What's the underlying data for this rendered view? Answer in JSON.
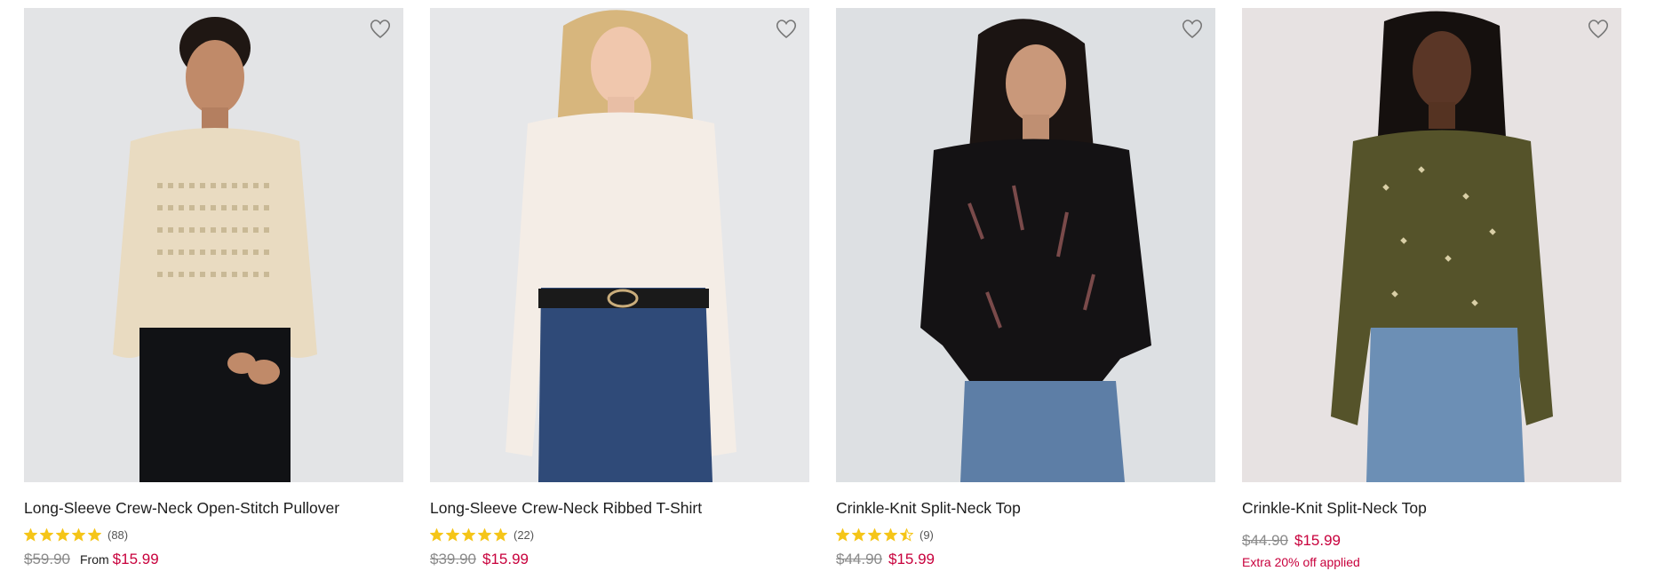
{
  "colors": {
    "sale": "#c8003c",
    "star": "#f5c518",
    "strike": "#8a8a8a"
  },
  "products": [
    {
      "title": "Long-Sleeve Crew-Neck Open-Stitch Pullover",
      "rating": 5,
      "rating_count": "(88)",
      "original_price": "$59.90",
      "price_prefix": "From",
      "sale_price": "$15.99",
      "image_icon": "model-photo",
      "wishlist_icon": "heart-outline-icon"
    },
    {
      "title": "Long-Sleeve Crew-Neck Ribbed T-Shirt",
      "rating": 5,
      "rating_count": "(22)",
      "original_price": "$39.90",
      "sale_price": "$15.99",
      "image_icon": "model-photo",
      "wishlist_icon": "heart-outline-icon"
    },
    {
      "title": "Crinkle-Knit Split-Neck Top",
      "rating": 4.5,
      "rating_count": "(9)",
      "original_price": "$44.90",
      "sale_price": "$15.99",
      "image_icon": "model-photo",
      "wishlist_icon": "heart-outline-icon"
    },
    {
      "title": "Crinkle-Knit Split-Neck Top",
      "original_price": "$44.90",
      "sale_price": "$15.99",
      "promo": "Extra 20% off applied",
      "image_icon": "model-photo",
      "wishlist_icon": "heart-outline-icon"
    }
  ]
}
